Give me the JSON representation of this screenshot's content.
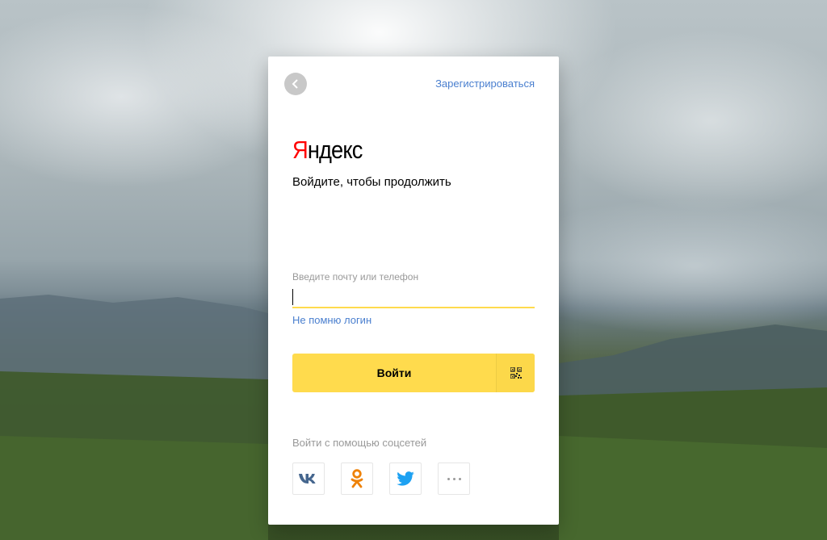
{
  "page": {
    "register_link": "Зарегистрироваться",
    "logo_first_letter": "Я",
    "logo_rest": "ндекс",
    "subtitle": "Войдите, чтобы продолжить"
  },
  "login_form": {
    "field_label": "Введите почту или телефон",
    "input_value": "",
    "forgot_link": "Не помню логин",
    "submit_label": "Войти"
  },
  "social": {
    "label": "Войти с помощью соцсетей",
    "providers": [
      "vk-icon",
      "odnoklassniki-icon",
      "twitter-icon",
      "more-icon"
    ]
  },
  "colors": {
    "accent_yellow": "#ffdb4d",
    "link_blue": "#4a7fcf",
    "logo_red": "#ff0000"
  }
}
